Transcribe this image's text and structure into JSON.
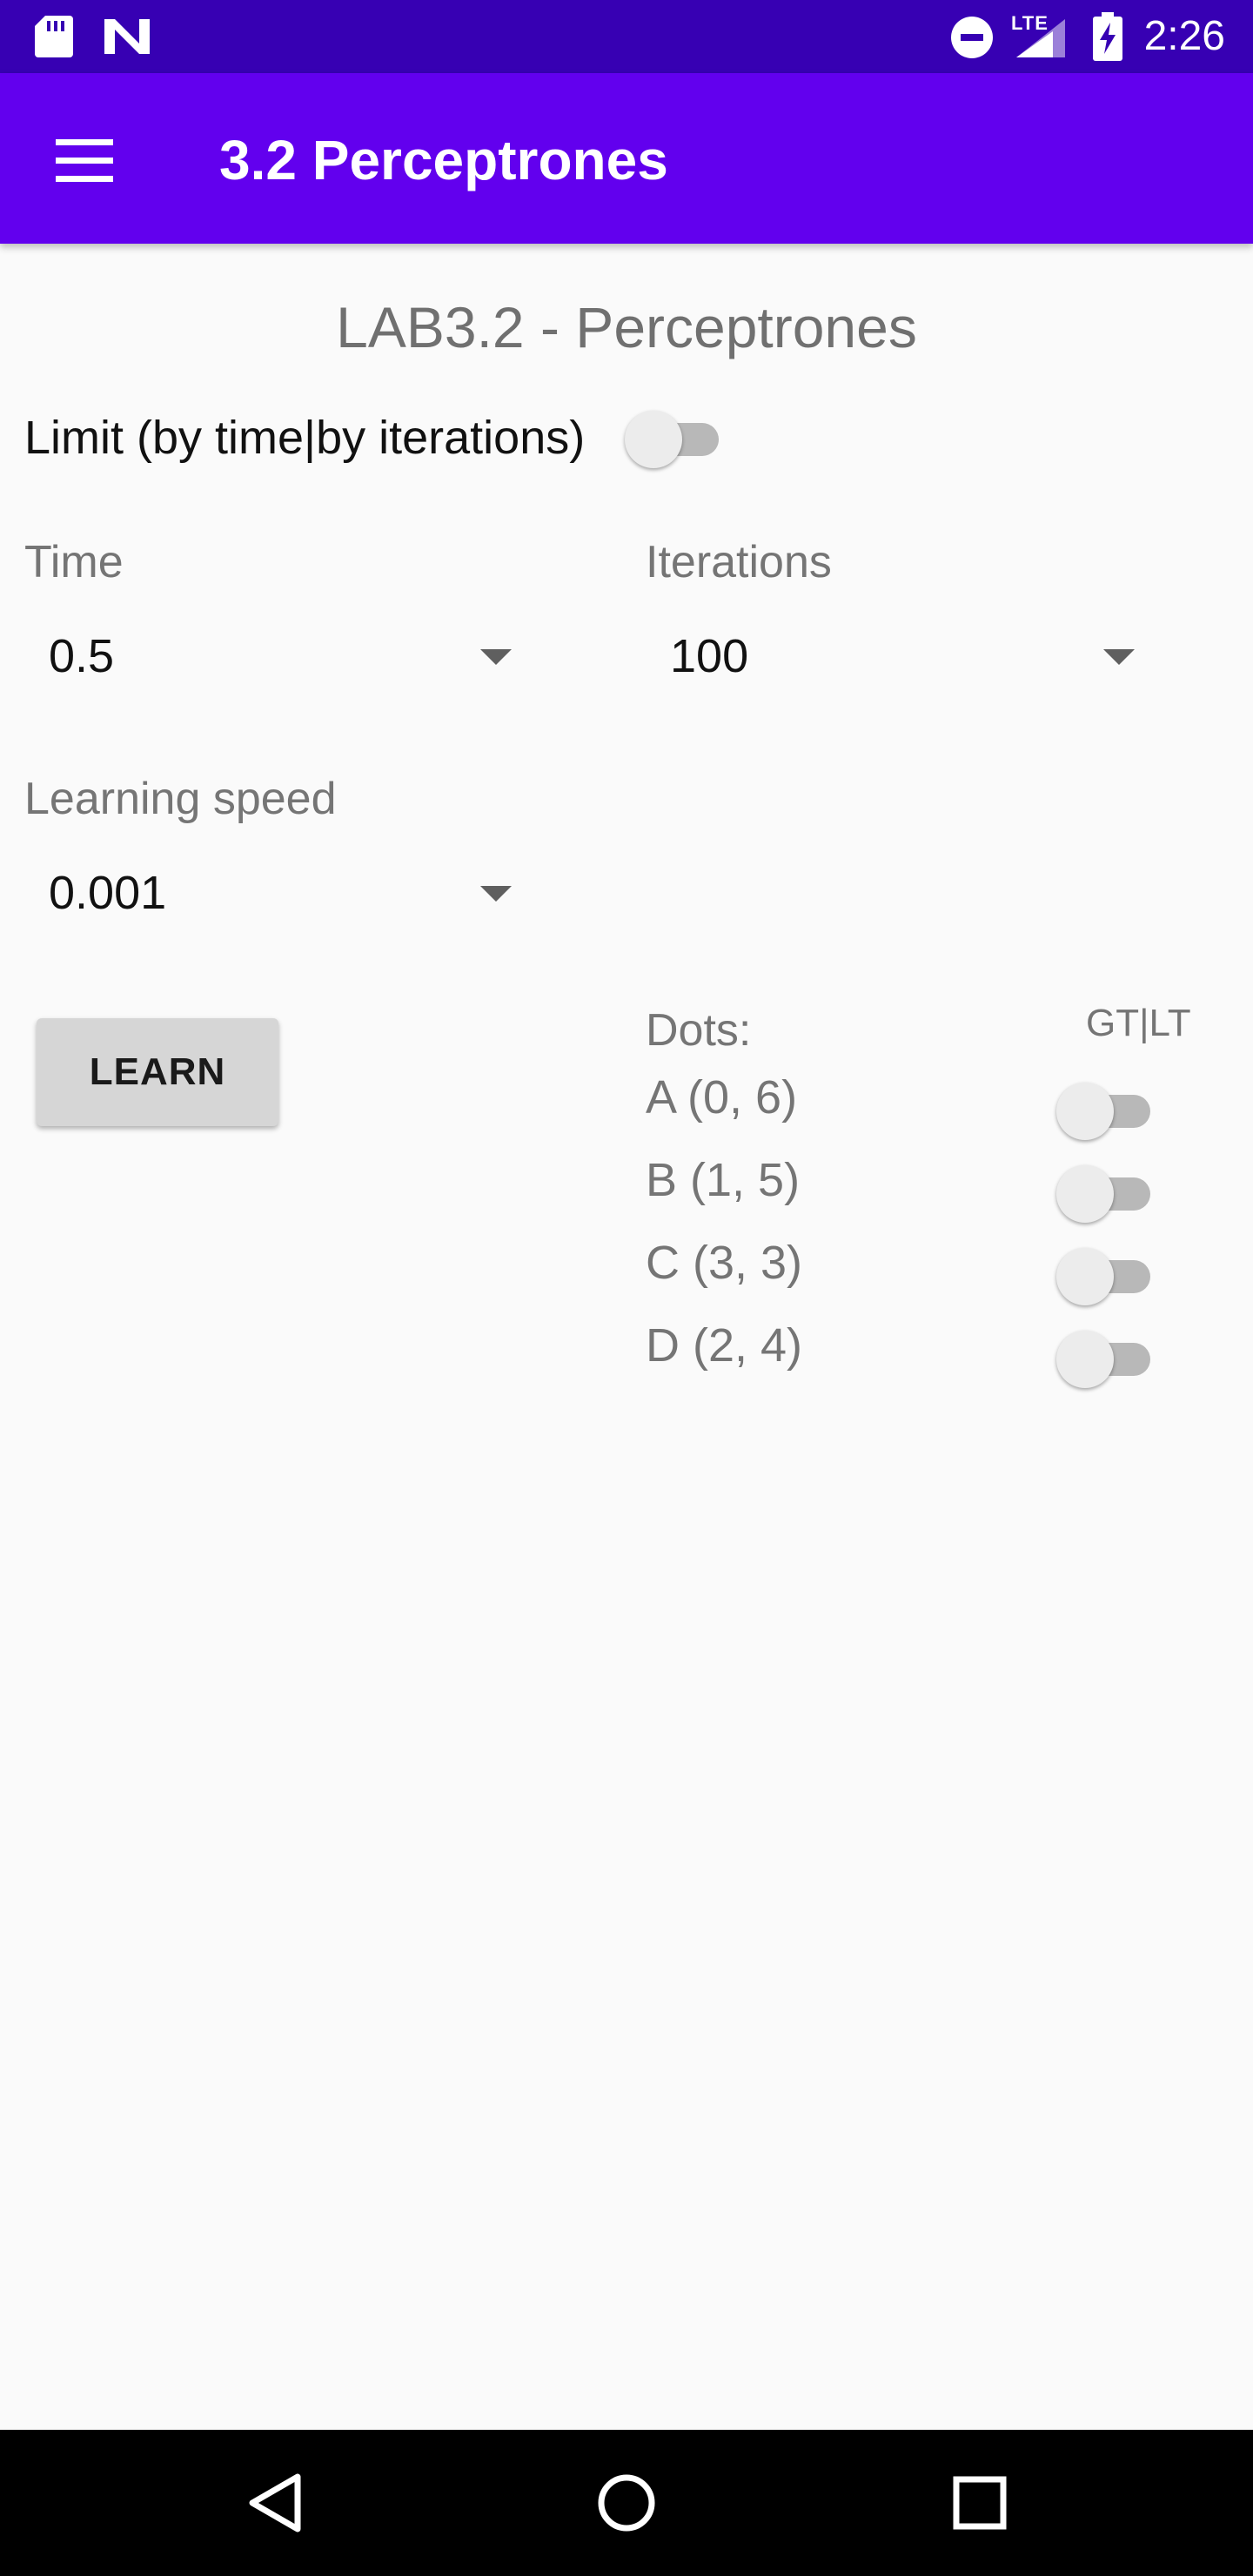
{
  "status_bar": {
    "time": "2:26",
    "network": "LTE",
    "icons": [
      "sd-card-icon",
      "n-logo-icon",
      "do-not-disturb-icon",
      "signal-icon",
      "battery-charging-icon"
    ]
  },
  "app_bar": {
    "title": "3.2 Perceptrones",
    "menu_icon": "menu-icon"
  },
  "content": {
    "heading": "LAB3.2 - Perceptrones",
    "limit": {
      "label": "Limit (by time|by iterations)",
      "checked": false
    },
    "time": {
      "label": "Time",
      "value": "0.5"
    },
    "iterations": {
      "label": "Iterations",
      "value": "100"
    },
    "learning_speed": {
      "label": "Learning speed",
      "value": "0.001"
    },
    "learn_button": "LEARN",
    "dots": {
      "label": "Dots:",
      "toggle_header": "GT|LT",
      "items": [
        {
          "label": "A (0, 6)",
          "checked": false
        },
        {
          "label": "B (1, 5)",
          "checked": false
        },
        {
          "label": "C (3, 3)",
          "checked": false
        },
        {
          "label": "D (2, 4)",
          "checked": false
        }
      ]
    }
  },
  "nav_bar": {
    "buttons": [
      "back-icon",
      "home-icon",
      "recents-icon"
    ]
  },
  "colors": {
    "status_bar": "#3700b3",
    "app_bar": "#6200ee",
    "background": "#fafafa"
  }
}
